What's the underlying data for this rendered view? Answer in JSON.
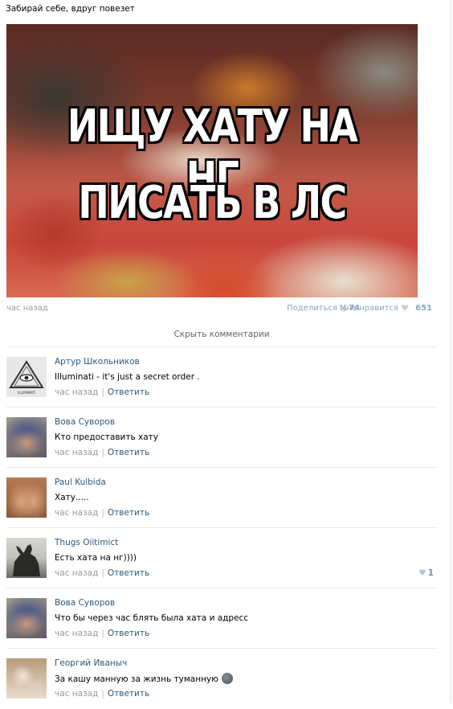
{
  "post": {
    "text": "Забирай себе, вдруг повезет",
    "image_caption_line1": "ИЩУ ХАТУ НА НГ",
    "image_caption_line2": "ПИСАТЬ В ЛС",
    "time": "час назад",
    "share_label": "Поделиться",
    "share_count": "74",
    "like_label": "Мне нравится",
    "like_count": "651",
    "hide_comments_label": "Скрыть комментарии"
  },
  "comments": [
    {
      "author": "Артур Школьников",
      "text": "Illuminati - it's just a secret order .",
      "time": "час назад",
      "reply": "Ответить",
      "likes": ""
    },
    {
      "author": "Вова Суворов",
      "text": "Кто предоставить хату",
      "time": "час назад",
      "reply": "Ответить",
      "likes": ""
    },
    {
      "author": "Paul Kulbida",
      "text": "Хату.....",
      "time": "час назад",
      "reply": "Ответить",
      "likes": ""
    },
    {
      "author": "Thugs Oiitimict",
      "text": "Есть хата на нг))))",
      "time": "час назад",
      "reply": "Ответить",
      "likes": "1"
    },
    {
      "author": "Вова Суворов",
      "text": "Что бы через час блять была хата и адресс",
      "time": "час назад",
      "reply": "Ответить",
      "likes": ""
    },
    {
      "author": "Георгий Иваныч",
      "text": "За кашу манную за жизнь туманную",
      "time": "час назад",
      "reply": "Ответить",
      "likes": ""
    }
  ],
  "illuminati_avatar_text": "ILLUMINATI",
  "colors": {
    "link": "#2b587a",
    "meta": "#999999",
    "like_accent": "#8aa6c1"
  },
  "icons": {
    "share": "megaphone-icon",
    "like": "heart-icon",
    "comment_like": "heart-icon",
    "emoji": "smiley-icon"
  }
}
